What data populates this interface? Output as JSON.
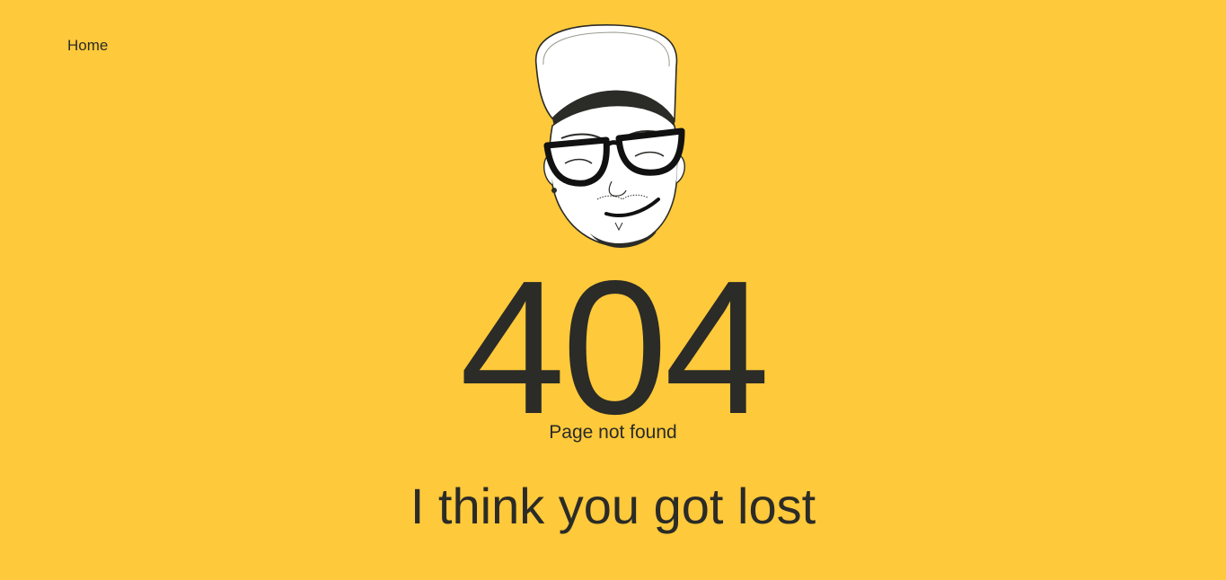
{
  "nav": {
    "home_label": "Home"
  },
  "error": {
    "code": "404",
    "title": "Page not found",
    "message": "I think you got lost"
  },
  "avatar": {
    "icon": "cartoon-face-with-cap-and-glasses"
  },
  "colors": {
    "background": "#fec93a",
    "text": "#2b2b27"
  }
}
